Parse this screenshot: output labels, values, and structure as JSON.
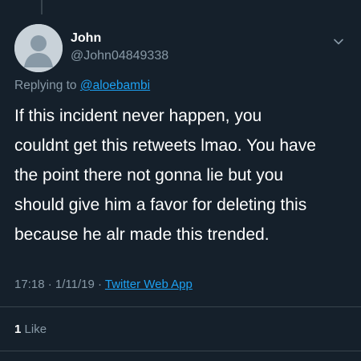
{
  "tweet": {
    "author": {
      "display_name": "John",
      "handle": "@John04849338",
      "avatar": "default-avatar-icon"
    },
    "replying_to_prefix": "Replying to ",
    "replying_to_handle": "@aloebambi",
    "text": "If this incident never happen, you\ncouldnt get this retweets lmao. You have\nthe point there not gonna lie but you\nshould give him a favor for deleting this\nbecause he alr made this trended.",
    "time": "17:18",
    "date": "1/11/19",
    "separator": " · ",
    "source": "Twitter Web App",
    "likes_count": "1",
    "likes_label": "Like"
  },
  "colors": {
    "background": "#15202b",
    "text_primary": "#ffffff",
    "text_secondary": "#8899a6",
    "accent": "#1da1f2",
    "border": "#38444d"
  },
  "icons": {
    "menu": "chevron-down-icon"
  }
}
